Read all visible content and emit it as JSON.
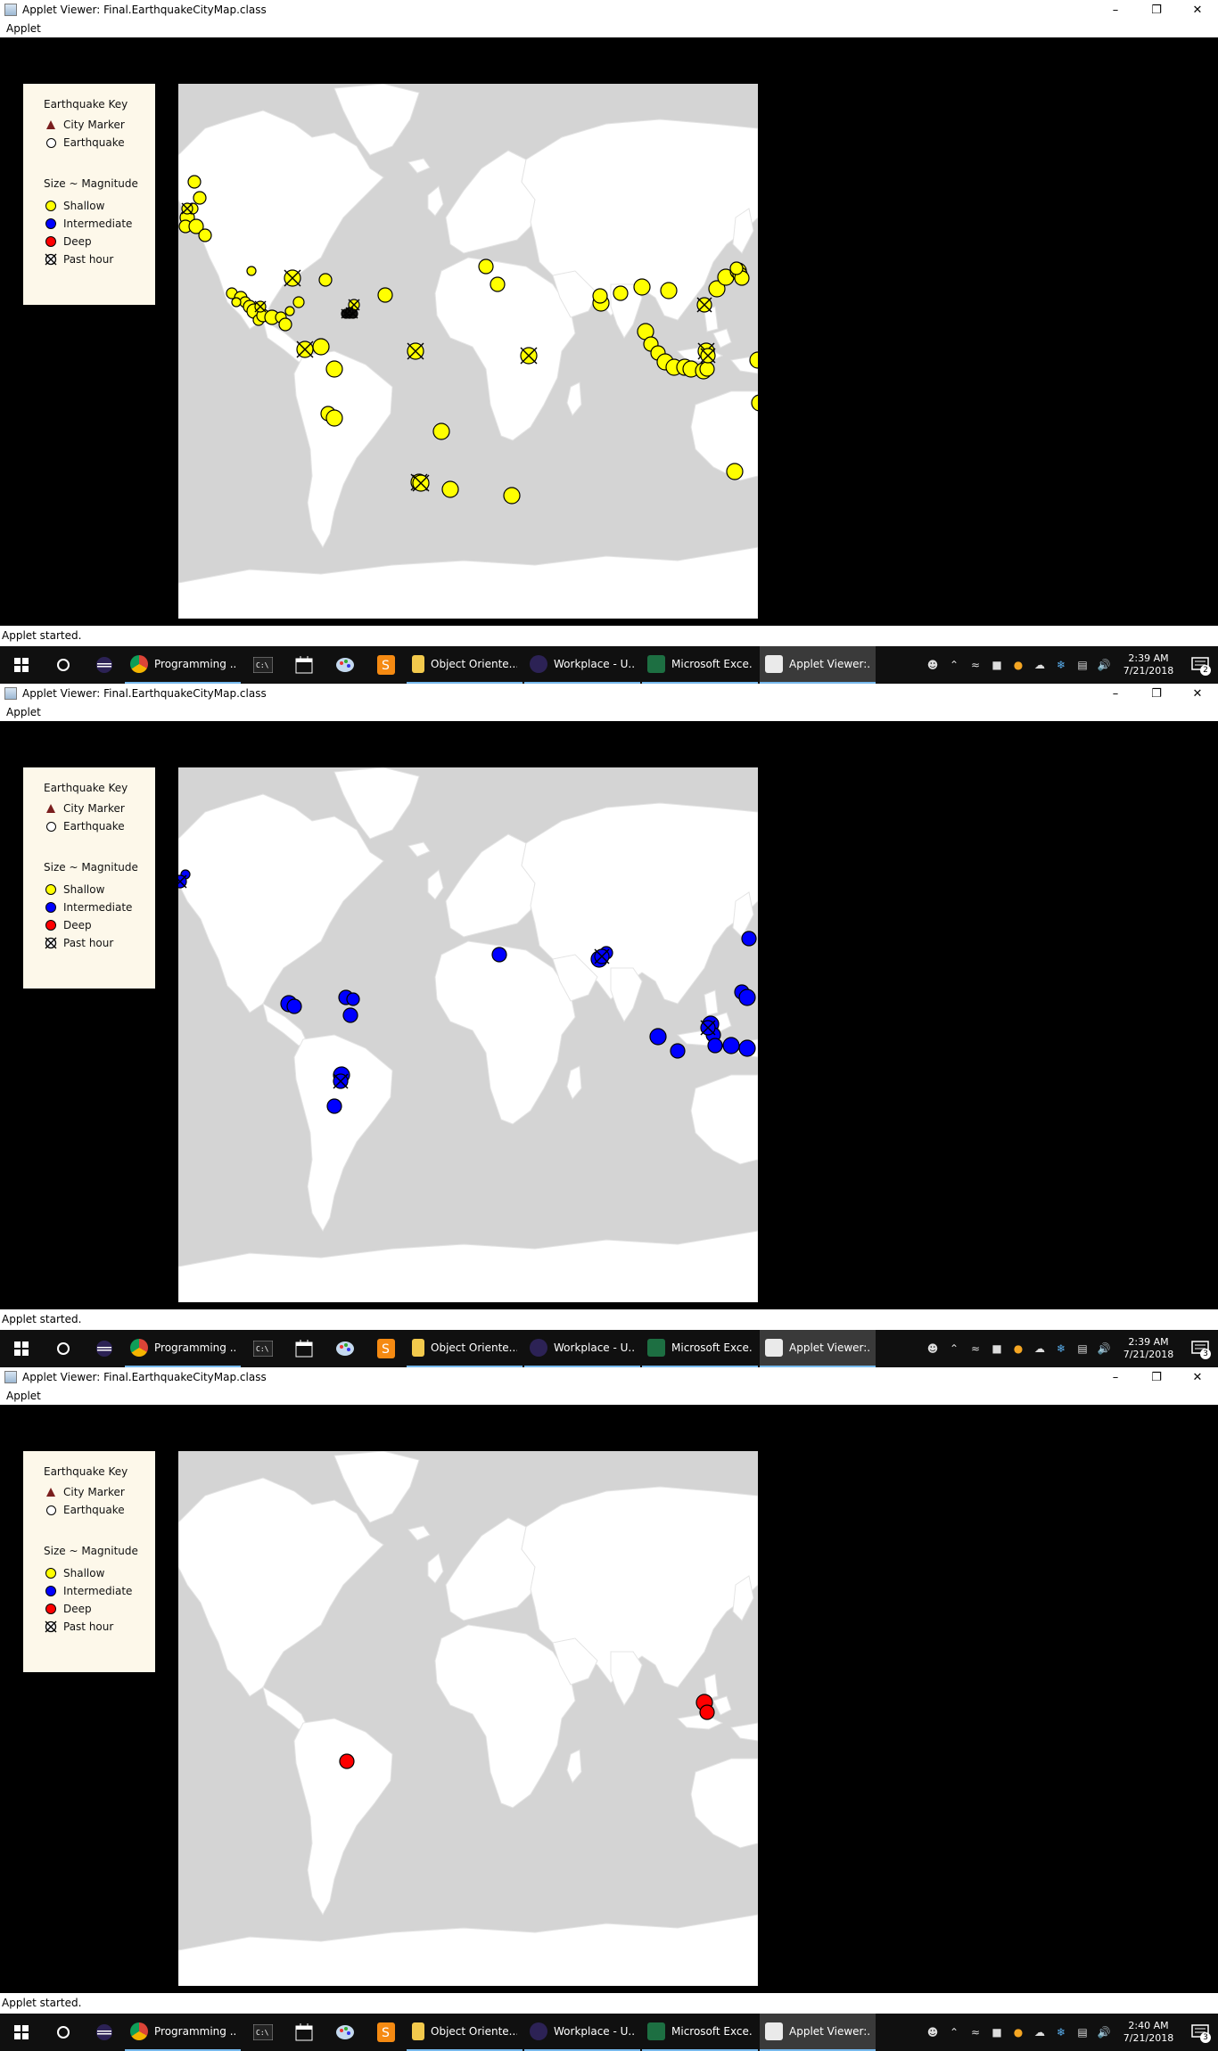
{
  "window": {
    "title": "Applet Viewer: Final.EarthquakeCityMap.class",
    "menu_label": "Applet",
    "status_text": "Applet started."
  },
  "legend": {
    "title": "Earthquake Key",
    "city_marker": "City Marker",
    "earthquake": "Earthquake",
    "size_label": "Size ~ Magnitude",
    "shallow": "Shallow",
    "intermediate": "Intermediate",
    "deep": "Deep",
    "past_hour": "Past hour"
  },
  "colors": {
    "shallow": "#ffff00",
    "intermediate": "#0000ff",
    "deep": "#ff0000",
    "map_land": "#ffffff",
    "map_ocean": "#d4d4d4",
    "legend_bg": "#fdf8ea"
  },
  "taskbar": {
    "apps": [
      {
        "icon": "chrome-icon",
        "label": "Programming ..."
      },
      {
        "icon": "folder-icon",
        "label": "Object Oriente..."
      },
      {
        "icon": "eclipse-icon",
        "label": "Workplace - U..."
      },
      {
        "icon": "excel-icon",
        "label": "Microsoft Exce..."
      },
      {
        "icon": "java-icon",
        "label": "Applet Viewer:..."
      }
    ]
  },
  "screens": [
    {
      "time": "2:39 AM",
      "date": "7/21/2018",
      "notifications": "2",
      "filter": "shallow"
    },
    {
      "time": "2:39 AM",
      "date": "7/21/2018",
      "notifications": "3",
      "filter": "intermediate"
    },
    {
      "time": "2:40 AM",
      "date": "7/21/2018",
      "notifications": "3",
      "filter": "deep"
    }
  ]
}
